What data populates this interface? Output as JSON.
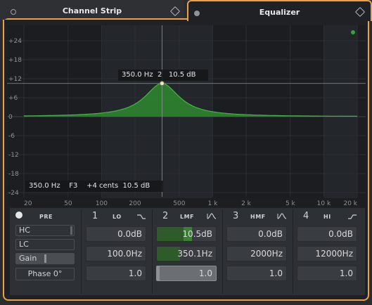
{
  "tabs": {
    "left": {
      "title": "Channel Strip"
    },
    "right": {
      "title": "Equalizer"
    }
  },
  "graph": {
    "y_labels": [
      "+24",
      "+18",
      "+12",
      "+6",
      "0",
      "-6",
      "-12",
      "-18",
      "-24"
    ],
    "x_labels": [
      "20",
      "50",
      "100",
      "200",
      "500",
      "1 k",
      "2 k",
      "5 k",
      "10 k",
      "20 k"
    ],
    "hover": {
      "freq": "350.0 Hz",
      "band": "2",
      "gain": "10.5 dB"
    },
    "footer": {
      "freq": "350.0 Hz",
      "note": "F3",
      "cents": "+4 cents",
      "gain": "10.5 dB"
    },
    "peak": {
      "freq_hz": 350,
      "gain_db": 10.5,
      "q": 1.0
    },
    "colors": {
      "curve": "#2e9a2e",
      "led": "#33a63a",
      "accent": "#e8a34a"
    }
  },
  "pre": {
    "label": "PRE",
    "hc": "HC",
    "lc": "LC",
    "gain": "Gain",
    "phase": "Phase 0°"
  },
  "bands": [
    {
      "num": "1",
      "name": "LO",
      "shape_icon": "low-shelf-icon",
      "gain": "0.0dB",
      "freq": "100.0Hz",
      "q": "1.0"
    },
    {
      "num": "2",
      "name": "LMF",
      "shape_icon": "peak-icon",
      "gain": "10.5dB",
      "freq": "350.1Hz",
      "q": "1.0"
    },
    {
      "num": "3",
      "name": "HMF",
      "shape_icon": "peak-icon",
      "gain": "0.0dB",
      "freq": "2000Hz",
      "q": "1.0"
    },
    {
      "num": "4",
      "name": "HI",
      "shape_icon": "high-shelf-icon",
      "gain": "0.0dB",
      "freq": "12000Hz",
      "q": "1.0"
    }
  ]
}
